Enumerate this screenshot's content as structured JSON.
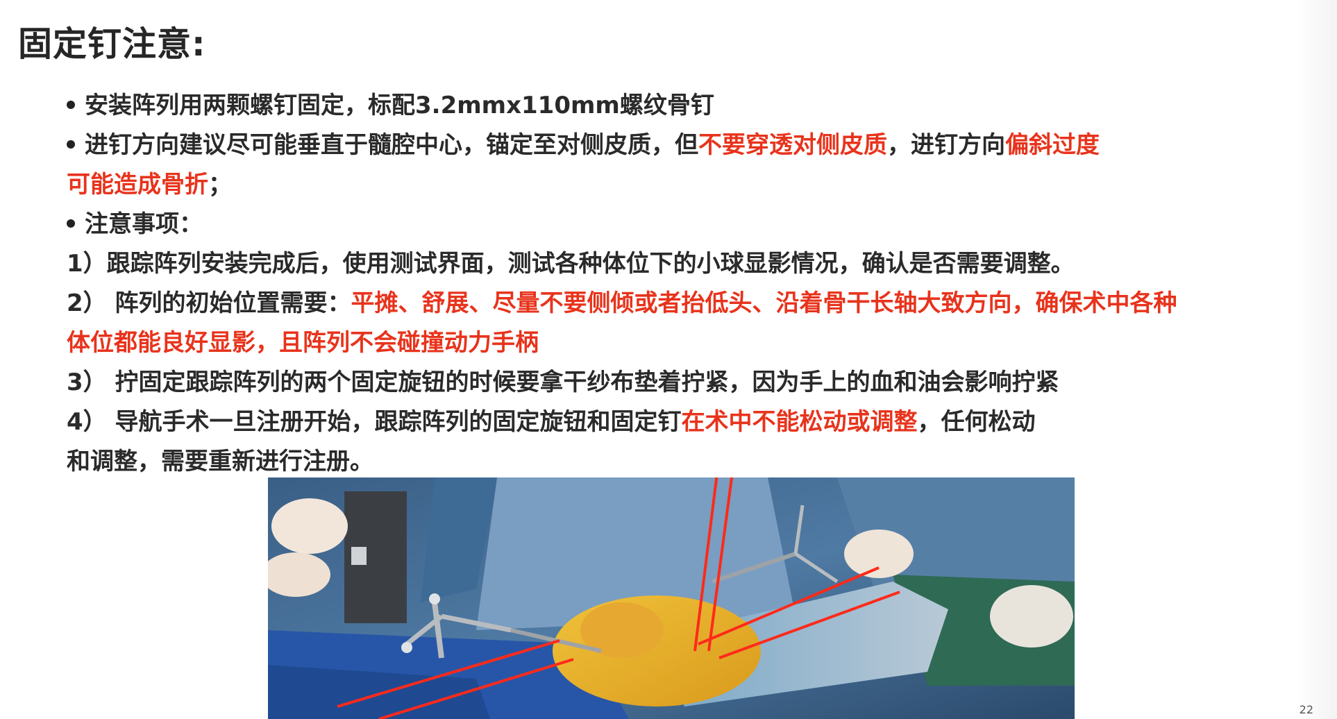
{
  "slide": {
    "title": "固定钉注意:",
    "page_number": "22",
    "lines": [
      {
        "bullet": true,
        "segments": [
          {
            "text": "安装阵列用两颗螺钉固定，标配3.2mmx110mm螺纹骨钉",
            "red": false
          }
        ]
      },
      {
        "bullet": true,
        "segments": [
          {
            "text": "进钉方向建议尽可能垂直于髓腔中心，锚定至对侧皮质，但",
            "red": false
          },
          {
            "text": "不要穿透对侧皮质",
            "red": true
          },
          {
            "text": "，进钉方向",
            "red": false
          },
          {
            "text": "偏斜过度",
            "red": true
          }
        ]
      },
      {
        "bullet": false,
        "segments": [
          {
            "text": "可能造成骨折",
            "red": true
          },
          {
            "text": "；",
            "red": false
          }
        ]
      },
      {
        "bullet": true,
        "segments": [
          {
            "text": "注意事项：",
            "red": false
          }
        ]
      },
      {
        "bullet": false,
        "segments": [
          {
            "text": "1）跟踪阵列安装完成后，使用测试界面，测试各种体位下的小球显影情况，确认是否需要调整。",
            "red": false
          }
        ]
      },
      {
        "bullet": false,
        "segments": [
          {
            "text": "2） 阵列的初始位置需要：",
            "red": false
          },
          {
            "text": "平摊、舒展、尽量不要侧倾或者抬低头、沿着骨干长轴大致方向，确保术中各种",
            "red": true
          }
        ]
      },
      {
        "bullet": false,
        "segments": [
          {
            "text": "体位都能良好显影，且阵列不会碰撞动力手柄",
            "red": true
          }
        ]
      },
      {
        "bullet": false,
        "segments": [
          {
            "text": "3） 拧固定跟踪阵列的两个固定旋钮的时候要拿干纱布垫着拧紧，因为手上的血和油会影响拧紧",
            "red": false
          }
        ]
      },
      {
        "bullet": false,
        "segments": [
          {
            "text": "4） 导航手术一旦注册开始，跟踪阵列的固定旋钮和固定钉",
            "red": false
          },
          {
            "text": "在术中不能松动或调整",
            "red": true
          },
          {
            "text": "，任何松动",
            "red": false
          }
        ]
      },
      {
        "bullet": false,
        "segments": [
          {
            "text": "和调整，需要重新进行注册。",
            "red": false
          }
        ]
      }
    ]
  },
  "colors": {
    "text": "#2a2a2a",
    "highlight_red": "#e8331c",
    "annotation_red": "#ff2a1a"
  }
}
